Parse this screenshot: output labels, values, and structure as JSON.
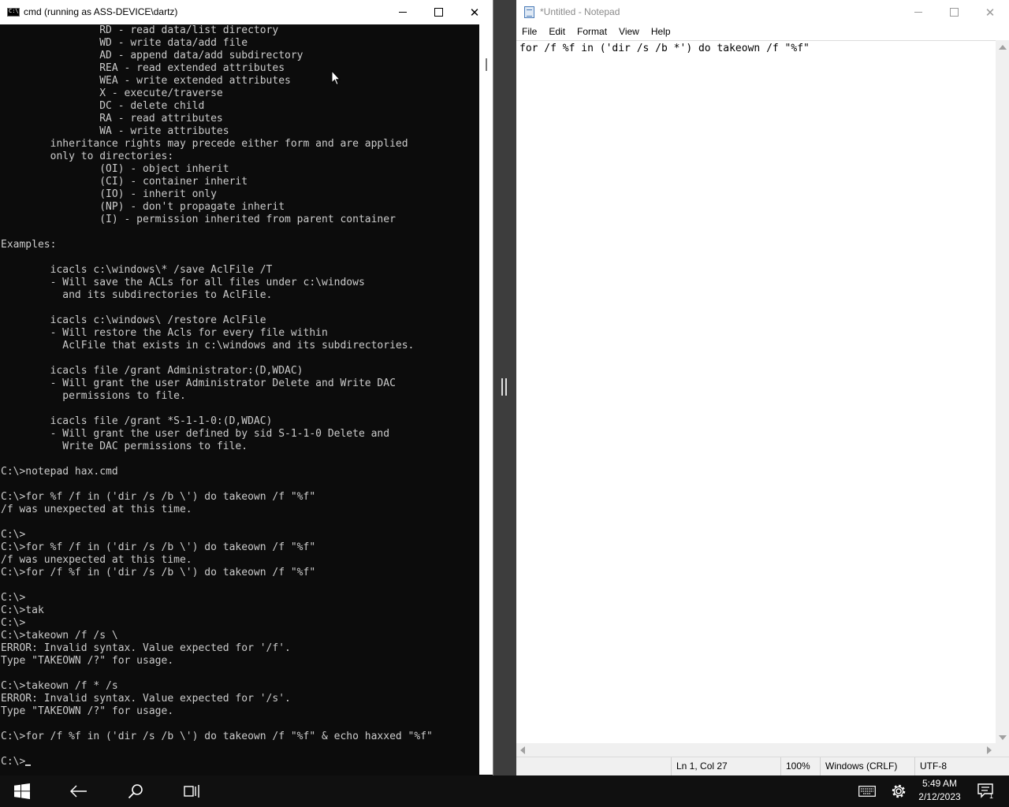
{
  "cmd": {
    "title": "cmd (running as ASS-DEVICE\\dartz)",
    "lines": [
      "                RD - read data/list directory",
      "                WD - write data/add file",
      "                AD - append data/add subdirectory",
      "                REA - read extended attributes",
      "                WEA - write extended attributes",
      "                X - execute/traverse",
      "                DC - delete child",
      "                RA - read attributes",
      "                WA - write attributes",
      "        inheritance rights may precede either form and are applied",
      "        only to directories:",
      "                (OI) - object inherit",
      "                (CI) - container inherit",
      "                (IO) - inherit only",
      "                (NP) - don't propagate inherit",
      "                (I) - permission inherited from parent container",
      "",
      "Examples:",
      "",
      "        icacls c:\\windows\\* /save AclFile /T",
      "        - Will save the ACLs for all files under c:\\windows",
      "          and its subdirectories to AclFile.",
      "",
      "        icacls c:\\windows\\ /restore AclFile",
      "        - Will restore the Acls for every file within",
      "          AclFile that exists in c:\\windows and its subdirectories.",
      "",
      "        icacls file /grant Administrator:(D,WDAC)",
      "        - Will grant the user Administrator Delete and Write DAC",
      "          permissions to file.",
      "",
      "        icacls file /grant *S-1-1-0:(D,WDAC)",
      "        - Will grant the user defined by sid S-1-1-0 Delete and",
      "          Write DAC permissions to file.",
      "",
      "C:\\>notepad hax.cmd",
      "",
      "C:\\>for %f /f in ('dir /s /b \\') do takeown /f \"%f\"",
      "/f was unexpected at this time.",
      "",
      "C:\\>",
      "C:\\>for %f /f in ('dir /s /b \\') do takeown /f \"%f\"",
      "/f was unexpected at this time.",
      "C:\\>for /f %f in ('dir /s /b \\') do takeown /f \"%f\"",
      "",
      "C:\\>",
      "C:\\>tak",
      "C:\\>",
      "C:\\>takeown /f /s \\",
      "ERROR: Invalid syntax. Value expected for '/f'.",
      "Type \"TAKEOWN /?\" for usage.",
      "",
      "C:\\>takeown /f * /s",
      "ERROR: Invalid syntax. Value expected for '/s'.",
      "Type \"TAKEOWN /?\" for usage.",
      "",
      "C:\\>for /f %f in ('dir /s /b \\') do takeown /f \"%f\" & echo haxxed \"%f\"",
      ""
    ],
    "prompt": "C:\\>",
    "text_color": "#cccccc",
    "background": "#0c0c0c"
  },
  "notepad": {
    "title": "*Untitled - Notepad",
    "menu": [
      "File",
      "Edit",
      "Format",
      "View",
      "Help"
    ],
    "content": "for /f %f in ('dir /s /b *') do takeown /f \"%f\"",
    "status": {
      "position": "Ln 1, Col 27",
      "zoom": "100%",
      "line_ending": "Windows (CRLF)",
      "encoding": "UTF-8"
    }
  },
  "taskbar": {
    "time": "5:49 AM",
    "date": "2/12/2023",
    "icons": [
      "windows-start-icon",
      "back-arrow-icon",
      "search-icon",
      "task-view-icon",
      "keyboard-icon",
      "settings-gear-icon",
      "notification-icon"
    ],
    "notification_count": "1"
  }
}
